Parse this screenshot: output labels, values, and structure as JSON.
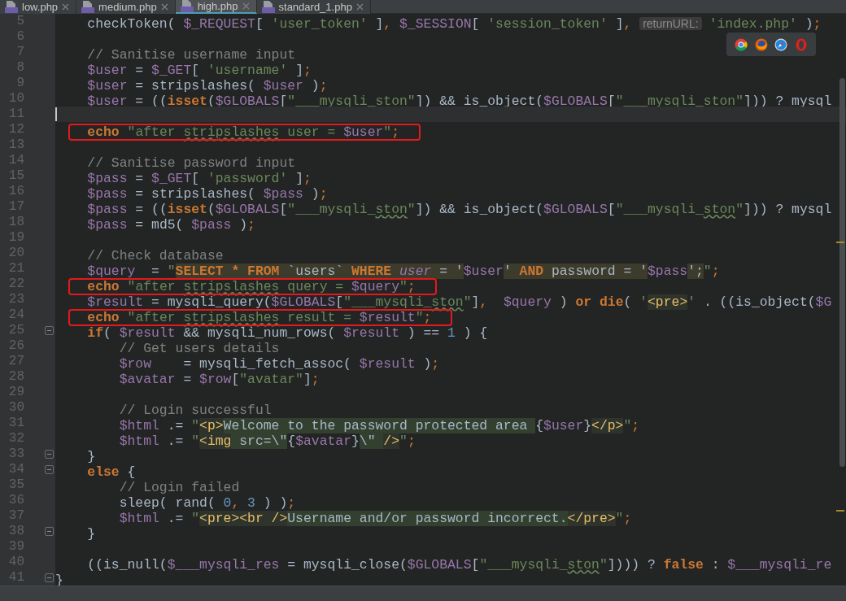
{
  "tabs": [
    {
      "label": "low.php",
      "selected": false
    },
    {
      "label": "medium.php",
      "selected": false
    },
    {
      "label": "high.php",
      "selected": true
    },
    {
      "label": "standard_1.php",
      "selected": false
    }
  ],
  "editor": {
    "lines": [
      {
        "number": "5",
        "tokens": [
          {
            "kind": "plain",
            "text": "    checkToken( "
          },
          {
            "kind": "variable",
            "text": "$_REQUEST"
          },
          {
            "kind": "plain",
            "text": "[ "
          },
          {
            "kind": "string",
            "text": "'user_token'"
          },
          {
            "kind": "plain",
            "text": " ]"
          },
          {
            "kind": "punct",
            "text": ", "
          },
          {
            "kind": "variable",
            "text": "$_SESSION"
          },
          {
            "kind": "plain",
            "text": "[ "
          },
          {
            "kind": "string",
            "text": "'session_token'"
          },
          {
            "kind": "plain",
            "text": " ]"
          },
          {
            "kind": "punct",
            "text": ", "
          },
          {
            "kind": "hint",
            "text": "returnURL:"
          },
          {
            "kind": "string",
            "text": "'index.php'"
          },
          {
            "kind": "plain",
            "text": " )"
          },
          {
            "kind": "punct",
            "text": ";"
          }
        ]
      },
      {
        "number": "6"
      },
      {
        "number": "7",
        "tokens": [
          {
            "kind": "comment",
            "text": "    // Sanitise username input"
          }
        ]
      },
      {
        "number": "8",
        "tokens": [
          {
            "kind": "variable",
            "text": "    $user"
          },
          {
            "kind": "plain",
            "text": " = "
          },
          {
            "kind": "variable",
            "text": "$_GET"
          },
          {
            "kind": "plain",
            "text": "[ "
          },
          {
            "kind": "string",
            "text": "'username'"
          },
          {
            "kind": "plain",
            "text": " ]"
          },
          {
            "kind": "punct",
            "text": ";"
          }
        ]
      },
      {
        "number": "9",
        "tokens": [
          {
            "kind": "variable",
            "text": "    $user"
          },
          {
            "kind": "plain",
            "text": " = stripslashes( "
          },
          {
            "kind": "variable",
            "text": "$user"
          },
          {
            "kind": "plain",
            "text": " )"
          },
          {
            "kind": "punct",
            "text": ";"
          }
        ]
      },
      {
        "number": "10",
        "tokens": [
          {
            "kind": "variable",
            "text": "    $user"
          },
          {
            "kind": "plain",
            "text": " = (("
          },
          {
            "kind": "keyword",
            "text": "isset"
          },
          {
            "kind": "plain",
            "text": "("
          },
          {
            "kind": "variable",
            "text": "$GLOBALS"
          },
          {
            "kind": "plain",
            "text": "["
          },
          {
            "kind": "string",
            "text": "\"___mysqli_"
          },
          {
            "kind": "squiggle",
            "text": "ston"
          },
          {
            "kind": "string",
            "text": "\""
          },
          {
            "kind": "plain",
            "text": "]) && is_object("
          },
          {
            "kind": "variable",
            "text": "$GLOBALS"
          },
          {
            "kind": "plain",
            "text": "["
          },
          {
            "kind": "string",
            "text": "\"___mysqli_"
          },
          {
            "kind": "squiggle",
            "text": "ston"
          },
          {
            "kind": "string",
            "text": "\""
          },
          {
            "kind": "plain",
            "text": "])) ? mysql"
          }
        ]
      },
      {
        "number": "11",
        "current": true
      },
      {
        "number": "12",
        "boxed": true,
        "tokens": [
          {
            "kind": "keyword",
            "text": "    echo"
          },
          {
            "kind": "string",
            "text": " \"after "
          },
          {
            "kind": "squiggle",
            "text": "stripslashes"
          },
          {
            "kind": "string",
            "text": " user = "
          },
          {
            "kind": "variable",
            "text": "$user"
          },
          {
            "kind": "string",
            "text": "\""
          },
          {
            "kind": "punct",
            "text": ";"
          }
        ]
      },
      {
        "number": "13"
      },
      {
        "number": "14",
        "tokens": [
          {
            "kind": "comment",
            "text": "    // Sanitise password input"
          }
        ]
      },
      {
        "number": "15",
        "tokens": [
          {
            "kind": "variable",
            "text": "    $pass"
          },
          {
            "kind": "plain",
            "text": " = "
          },
          {
            "kind": "variable",
            "text": "$_GET"
          },
          {
            "kind": "plain",
            "text": "[ "
          },
          {
            "kind": "string",
            "text": "'password'"
          },
          {
            "kind": "plain",
            "text": " ]"
          },
          {
            "kind": "punct",
            "text": ";"
          }
        ]
      },
      {
        "number": "16",
        "tokens": [
          {
            "kind": "variable",
            "text": "    $pass"
          },
          {
            "kind": "plain",
            "text": " = stripslashes( "
          },
          {
            "kind": "variable",
            "text": "$pass"
          },
          {
            "kind": "plain",
            "text": " )"
          },
          {
            "kind": "punct",
            "text": ";"
          }
        ]
      },
      {
        "number": "17",
        "tokens": [
          {
            "kind": "variable",
            "text": "    $pass"
          },
          {
            "kind": "plain",
            "text": " = (("
          },
          {
            "kind": "keyword",
            "text": "isset"
          },
          {
            "kind": "plain",
            "text": "("
          },
          {
            "kind": "variable",
            "text": "$GLOBALS"
          },
          {
            "kind": "plain",
            "text": "["
          },
          {
            "kind": "string",
            "text": "\"___mysqli_"
          },
          {
            "kind": "squiggle",
            "text": "ston"
          },
          {
            "kind": "string",
            "text": "\""
          },
          {
            "kind": "plain",
            "text": "]) && is_object("
          },
          {
            "kind": "variable",
            "text": "$GLOBALS"
          },
          {
            "kind": "plain",
            "text": "["
          },
          {
            "kind": "string",
            "text": "\"___mysqli_"
          },
          {
            "kind": "squiggle",
            "text": "ston"
          },
          {
            "kind": "string",
            "text": "\""
          },
          {
            "kind": "plain",
            "text": "])) ? mysql"
          }
        ]
      },
      {
        "number": "18",
        "tokens": [
          {
            "kind": "variable",
            "text": "    $pass"
          },
          {
            "kind": "plain",
            "text": " = md5( "
          },
          {
            "kind": "variable",
            "text": "$pass"
          },
          {
            "kind": "plain",
            "text": " )"
          },
          {
            "kind": "punct",
            "text": ";"
          }
        ]
      },
      {
        "number": "19"
      },
      {
        "number": "20",
        "tokens": [
          {
            "kind": "comment",
            "text": "    // Check database"
          }
        ]
      },
      {
        "number": "21",
        "tokens": [
          {
            "kind": "variable",
            "text": "    $query"
          },
          {
            "kind": "plain",
            "text": "  = "
          },
          {
            "kind": "string",
            "text": "\""
          },
          {
            "kind": "sqlkw",
            "text": "SELECT * FROM"
          },
          {
            "kind": "sql",
            "text": " `users` "
          },
          {
            "kind": "sqlkw",
            "text": "WHERE"
          },
          {
            "kind": "sqlcol",
            "text": " user"
          },
          {
            "kind": "sql",
            "text": " = '"
          },
          {
            "kind": "variable",
            "text": "$user"
          },
          {
            "kind": "sql",
            "text": "' "
          },
          {
            "kind": "sqlkw",
            "text": "AND"
          },
          {
            "kind": "sql",
            "text": " password = '"
          },
          {
            "kind": "variable",
            "text": "$pass"
          },
          {
            "kind": "sql",
            "text": "';"
          },
          {
            "kind": "string",
            "text": "\""
          },
          {
            "kind": "punct",
            "text": ";"
          }
        ]
      },
      {
        "number": "22",
        "boxed": true,
        "tokens": [
          {
            "kind": "keyword",
            "text": "    echo"
          },
          {
            "kind": "string",
            "text": " \"after "
          },
          {
            "kind": "squiggle",
            "text": "stripslashes"
          },
          {
            "kind": "string",
            "text": " query = "
          },
          {
            "kind": "variable",
            "text": "$query"
          },
          {
            "kind": "string",
            "text": "\""
          },
          {
            "kind": "punct",
            "text": ";"
          }
        ]
      },
      {
        "number": "23",
        "tokens": [
          {
            "kind": "variable",
            "text": "    $result"
          },
          {
            "kind": "plain",
            "text": " = mysqli_query("
          },
          {
            "kind": "variable",
            "text": "$GLOBALS"
          },
          {
            "kind": "plain",
            "text": "["
          },
          {
            "kind": "string",
            "text": "\"___mysqli_"
          },
          {
            "kind": "squiggle",
            "text": "ston"
          },
          {
            "kind": "string",
            "text": "\""
          },
          {
            "kind": "plain",
            "text": "]"
          },
          {
            "kind": "punct",
            "text": ",  "
          },
          {
            "kind": "variable",
            "text": "$query"
          },
          {
            "kind": "plain",
            "text": " ) "
          },
          {
            "kind": "keyword",
            "text": "or"
          },
          {
            "kind": "keyword",
            "text": " die"
          },
          {
            "kind": "plain",
            "text": "( "
          },
          {
            "kind": "string",
            "text": "'"
          },
          {
            "kind": "tag",
            "text": "<pre>"
          },
          {
            "kind": "string",
            "text": "'"
          },
          {
            "kind": "plain",
            "text": " . ((is_object("
          },
          {
            "kind": "variable",
            "text": "$G"
          }
        ]
      },
      {
        "number": "24",
        "boxed": true,
        "tokens": [
          {
            "kind": "keyword",
            "text": "    echo"
          },
          {
            "kind": "string",
            "text": " \"after "
          },
          {
            "kind": "squiggle",
            "text": "stripslashes"
          },
          {
            "kind": "string",
            "text": " result = "
          },
          {
            "kind": "variable",
            "text": "$result"
          },
          {
            "kind": "string",
            "text": "\""
          },
          {
            "kind": "punct",
            "text": ";"
          }
        ]
      },
      {
        "number": "25",
        "fold": true,
        "tokens": [
          {
            "kind": "keyword",
            "text": "    if"
          },
          {
            "kind": "plain",
            "text": "( "
          },
          {
            "kind": "variable",
            "text": "$result"
          },
          {
            "kind": "plain",
            "text": " && mysqli_num_rows( "
          },
          {
            "kind": "variable",
            "text": "$result"
          },
          {
            "kind": "plain",
            "text": " ) == "
          },
          {
            "kind": "number",
            "text": "1"
          },
          {
            "kind": "plain",
            "text": " ) {"
          }
        ]
      },
      {
        "number": "26",
        "tokens": [
          {
            "kind": "comment",
            "text": "        // Get users details"
          }
        ]
      },
      {
        "number": "27",
        "tokens": [
          {
            "kind": "variable",
            "text": "        $row"
          },
          {
            "kind": "plain",
            "text": "    = mysqli_fetch_assoc( "
          },
          {
            "kind": "variable",
            "text": "$result"
          },
          {
            "kind": "plain",
            "text": " )"
          },
          {
            "kind": "punct",
            "text": ";"
          }
        ]
      },
      {
        "number": "28",
        "tokens": [
          {
            "kind": "variable",
            "text": "        $avatar"
          },
          {
            "kind": "plain",
            "text": " = "
          },
          {
            "kind": "variable",
            "text": "$row"
          },
          {
            "kind": "plain",
            "text": "["
          },
          {
            "kind": "string",
            "text": "\"avatar\""
          },
          {
            "kind": "plain",
            "text": "]"
          },
          {
            "kind": "punct",
            "text": ";"
          }
        ]
      },
      {
        "number": "29"
      },
      {
        "number": "30",
        "tokens": [
          {
            "kind": "comment",
            "text": "        // Login successful"
          }
        ]
      },
      {
        "number": "31",
        "tokens": [
          {
            "kind": "variable",
            "text": "        $html"
          },
          {
            "kind": "plain",
            "text": " .= "
          },
          {
            "kind": "string",
            "text": "\""
          },
          {
            "kind": "tag",
            "text": "<p>"
          },
          {
            "kind": "markup",
            "text": "Welcome to the password protected area "
          },
          {
            "kind": "plain",
            "text": "{"
          },
          {
            "kind": "variable",
            "text": "$user"
          },
          {
            "kind": "plain",
            "text": "}"
          },
          {
            "kind": "tag",
            "text": "</p>"
          },
          {
            "kind": "string",
            "text": "\""
          },
          {
            "kind": "punct",
            "text": ";"
          }
        ]
      },
      {
        "number": "32",
        "tokens": [
          {
            "kind": "variable",
            "text": "        $html"
          },
          {
            "kind": "plain",
            "text": " .= "
          },
          {
            "kind": "string",
            "text": "\""
          },
          {
            "kind": "tag",
            "text": "<img"
          },
          {
            "kind": "markup",
            "text": " src=\\\""
          },
          {
            "kind": "plain",
            "text": "{"
          },
          {
            "kind": "variable",
            "text": "$avatar"
          },
          {
            "kind": "plain",
            "text": "}"
          },
          {
            "kind": "markup",
            "text": "\\\" "
          },
          {
            "kind": "tag",
            "text": "/>"
          },
          {
            "kind": "string",
            "text": "\""
          },
          {
            "kind": "punct",
            "text": ";"
          }
        ]
      },
      {
        "number": "33",
        "fold": true,
        "tokens": [
          {
            "kind": "plain",
            "text": "    }"
          }
        ]
      },
      {
        "number": "34",
        "fold": true,
        "tokens": [
          {
            "kind": "keyword",
            "text": "    else"
          },
          {
            "kind": "plain",
            "text": " {"
          }
        ]
      },
      {
        "number": "35",
        "tokens": [
          {
            "kind": "comment",
            "text": "        // Login failed"
          }
        ]
      },
      {
        "number": "36",
        "tokens": [
          {
            "kind": "plain",
            "text": "        sleep( rand( "
          },
          {
            "kind": "number",
            "text": "0"
          },
          {
            "kind": "punct",
            "text": ", "
          },
          {
            "kind": "number",
            "text": "3"
          },
          {
            "kind": "plain",
            "text": " ) )"
          },
          {
            "kind": "punct",
            "text": ";"
          }
        ]
      },
      {
        "number": "37",
        "tokens": [
          {
            "kind": "variable",
            "text": "        $html"
          },
          {
            "kind": "plain",
            "text": " .= "
          },
          {
            "kind": "string",
            "text": "\""
          },
          {
            "kind": "tag",
            "text": "<pre><br />"
          },
          {
            "kind": "markup",
            "text": "Username and/or password incorrect."
          },
          {
            "kind": "tag",
            "text": "</pre>"
          },
          {
            "kind": "string",
            "text": "\""
          },
          {
            "kind": "punct",
            "text": ";"
          }
        ]
      },
      {
        "number": "38",
        "fold": true,
        "tokens": [
          {
            "kind": "plain",
            "text": "    }"
          }
        ]
      },
      {
        "number": "39"
      },
      {
        "number": "40",
        "tokens": [
          {
            "kind": "plain",
            "text": "    ((is_null("
          },
          {
            "kind": "variable",
            "text": "$___mysqli_res"
          },
          {
            "kind": "plain",
            "text": " = mysqli_close("
          },
          {
            "kind": "variable",
            "text": "$GLOBALS"
          },
          {
            "kind": "plain",
            "text": "["
          },
          {
            "kind": "string",
            "text": "\"___mysqli_"
          },
          {
            "kind": "squiggle",
            "text": "ston"
          },
          {
            "kind": "string",
            "text": "\""
          },
          {
            "kind": "plain",
            "text": "]))) ? "
          },
          {
            "kind": "keyword",
            "text": "false"
          },
          {
            "kind": "plain",
            "text": " : "
          },
          {
            "kind": "variable",
            "text": "$___mysqli_re"
          }
        ]
      },
      {
        "number": "41",
        "fold": true,
        "tokens": [
          {
            "kind": "plain",
            "text": "}"
          }
        ]
      }
    ]
  }
}
